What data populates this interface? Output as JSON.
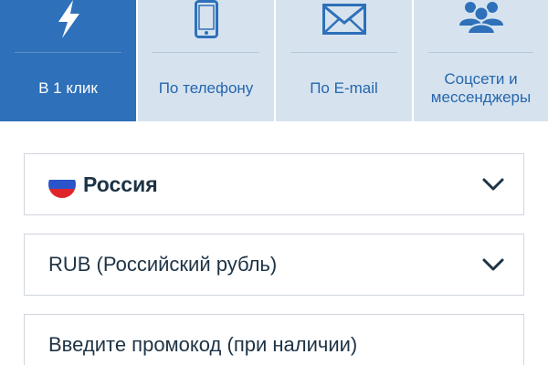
{
  "tabs": [
    {
      "label": "В 1 клик",
      "icon": "lightning-icon",
      "active": true
    },
    {
      "label": "По телефону",
      "icon": "phone-icon",
      "active": false
    },
    {
      "label": "По E-mail",
      "icon": "envelope-icon",
      "active": false
    },
    {
      "label": "Соцсети и\nмессенджеры",
      "icon": "people-icon",
      "active": false
    }
  ],
  "country": {
    "value": "Россия",
    "icon": "russia-flag-icon"
  },
  "currency": {
    "value": "RUB (Российский рубль)"
  },
  "promo": {
    "placeholder": "Введите промокод (при наличии)"
  },
  "colors": {
    "accent": "#2e70b9",
    "tab_background": "#d6e3ef",
    "text": "#1d3345"
  }
}
